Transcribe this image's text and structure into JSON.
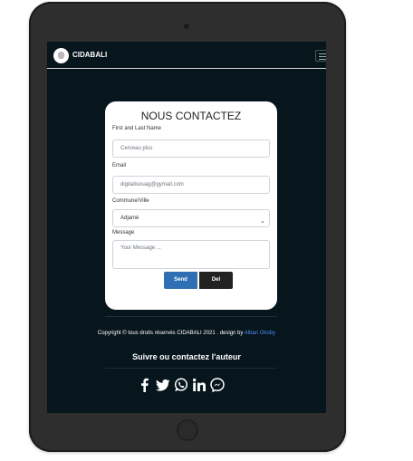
{
  "navbar": {
    "brand": "CIDABALI",
    "menu_icon": "hamburger-icon"
  },
  "contact_form": {
    "title": "NOUS CONTACTEZ",
    "name": {
      "label": "First and Last Name",
      "placeholder": "Cerveau plus"
    },
    "email": {
      "label": "Email",
      "placeholder": "digitalisouag@gymail.com"
    },
    "commune": {
      "label": "Commune/Ville",
      "selected": "Adjamé"
    },
    "message": {
      "label": "Message",
      "placeholder": "Your Message ..."
    },
    "send_label": "Send",
    "del_label": "Del"
  },
  "footer": {
    "copyright": "Copyright © tous droits réservés CIDABALI 2021 . design by",
    "author": "Alban Okoby",
    "follow": "Suivre ou contactez l'auteur",
    "socials": [
      "facebook-icon",
      "twitter-icon",
      "whatsapp-icon",
      "linkedin-icon",
      "messenger-icon"
    ]
  },
  "colors": {
    "screen_bg": "#07151c",
    "send_button": "#2f6fb3",
    "del_button": "#222222",
    "author_link": "#4d8df6"
  }
}
